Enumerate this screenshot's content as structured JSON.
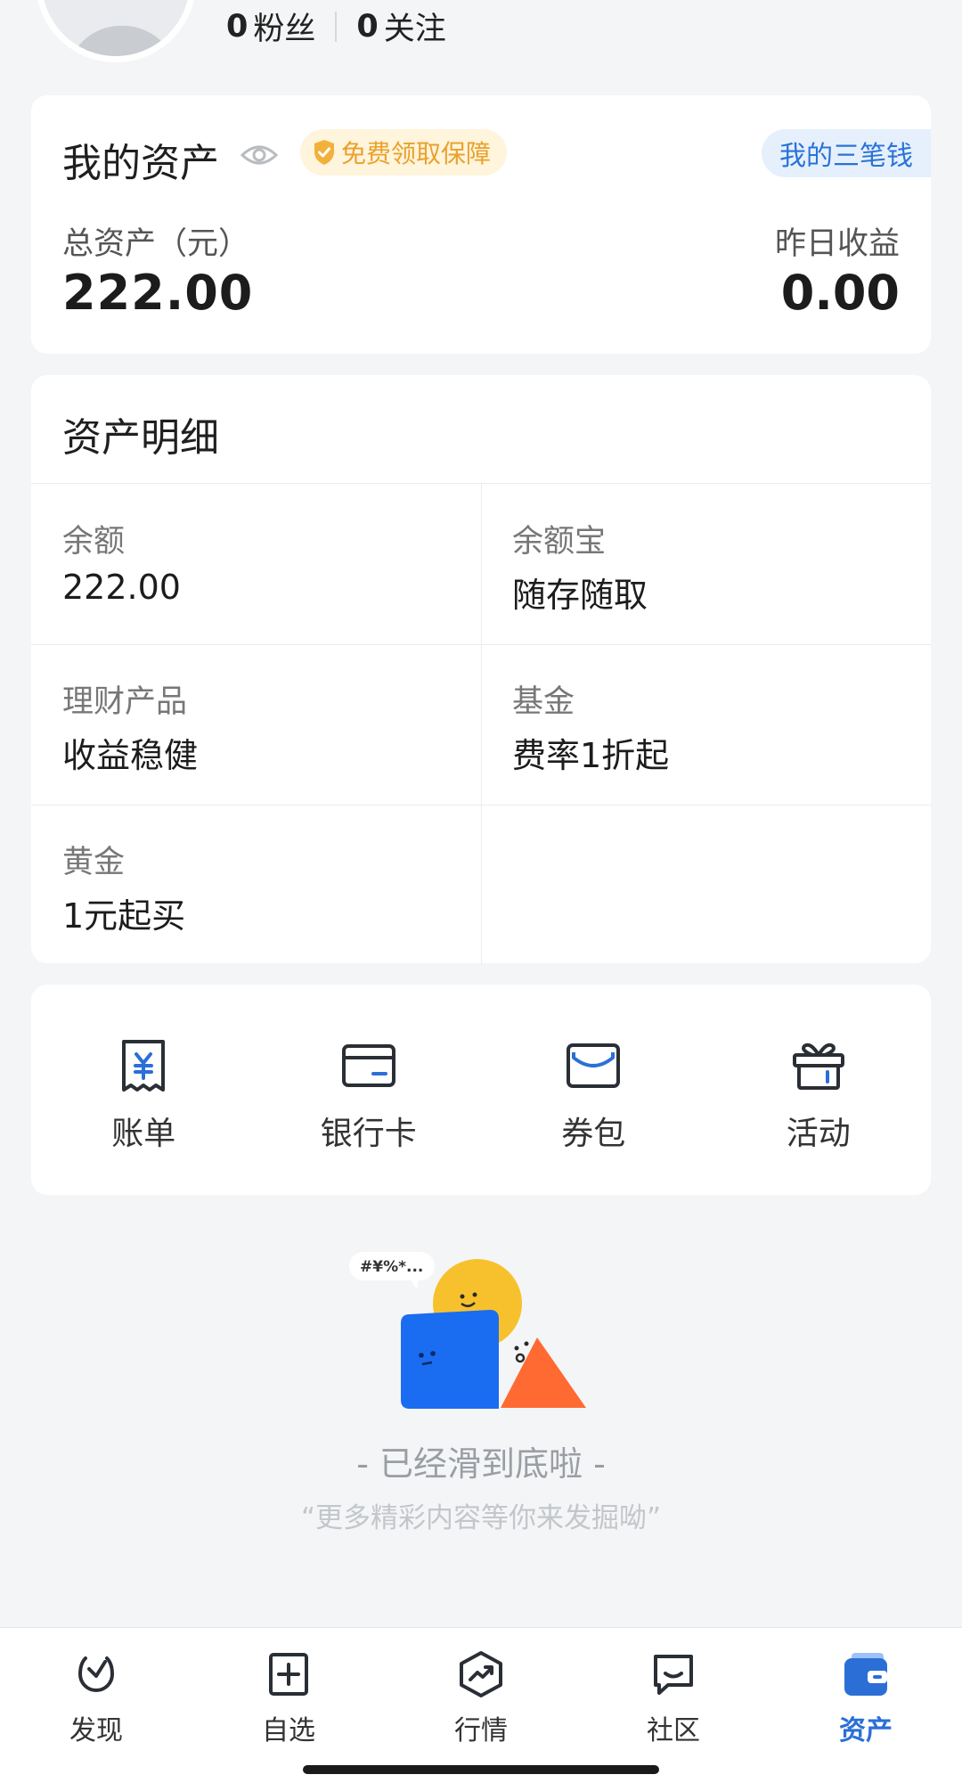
{
  "profile": {
    "fans_count": "0",
    "fans_label": "粉丝",
    "following_count": "0",
    "following_label": "关注"
  },
  "assets": {
    "title": "我的资产",
    "guarantee_badge": "免费领取保障",
    "three_money_tag": "我的三笔钱",
    "total_label": "总资产（元）",
    "total_value": "222.00",
    "yesterday_label": "昨日收益",
    "yesterday_value": "0.00"
  },
  "details": {
    "title": "资产明细",
    "items": [
      {
        "label": "余额",
        "value": "222.00"
      },
      {
        "label": "余额宝",
        "value": "随存随取"
      },
      {
        "label": "理财产品",
        "value": "收益稳健"
      },
      {
        "label": "基金",
        "value": "费率1折起"
      },
      {
        "label": "黄金",
        "value": "1元起买"
      }
    ]
  },
  "shortcuts": [
    {
      "label": "账单",
      "icon": "bill-icon"
    },
    {
      "label": "银行卡",
      "icon": "bank-card-icon"
    },
    {
      "label": "券包",
      "icon": "coupon-wallet-icon"
    },
    {
      "label": "活动",
      "icon": "gift-icon"
    }
  ],
  "end_of_list": {
    "bubble_text": "#¥%*...",
    "title": "- 已经滑到底啦 -",
    "subtitle": "“更多精彩内容等你来发掘呦”"
  },
  "tabs": [
    {
      "label": "发现",
      "icon": "discover-icon",
      "active": false
    },
    {
      "label": "自选",
      "icon": "watchlist-add-icon",
      "active": false
    },
    {
      "label": "行情",
      "icon": "market-trend-icon",
      "active": false
    },
    {
      "label": "社区",
      "icon": "community-chat-icon",
      "active": false
    },
    {
      "label": "资产",
      "icon": "assets-wallet-icon",
      "active": true
    }
  ],
  "colors": {
    "accent_blue": "#2b6fd6",
    "badge_gold": "#e9a12a",
    "page_background": "#f4f5f6"
  }
}
